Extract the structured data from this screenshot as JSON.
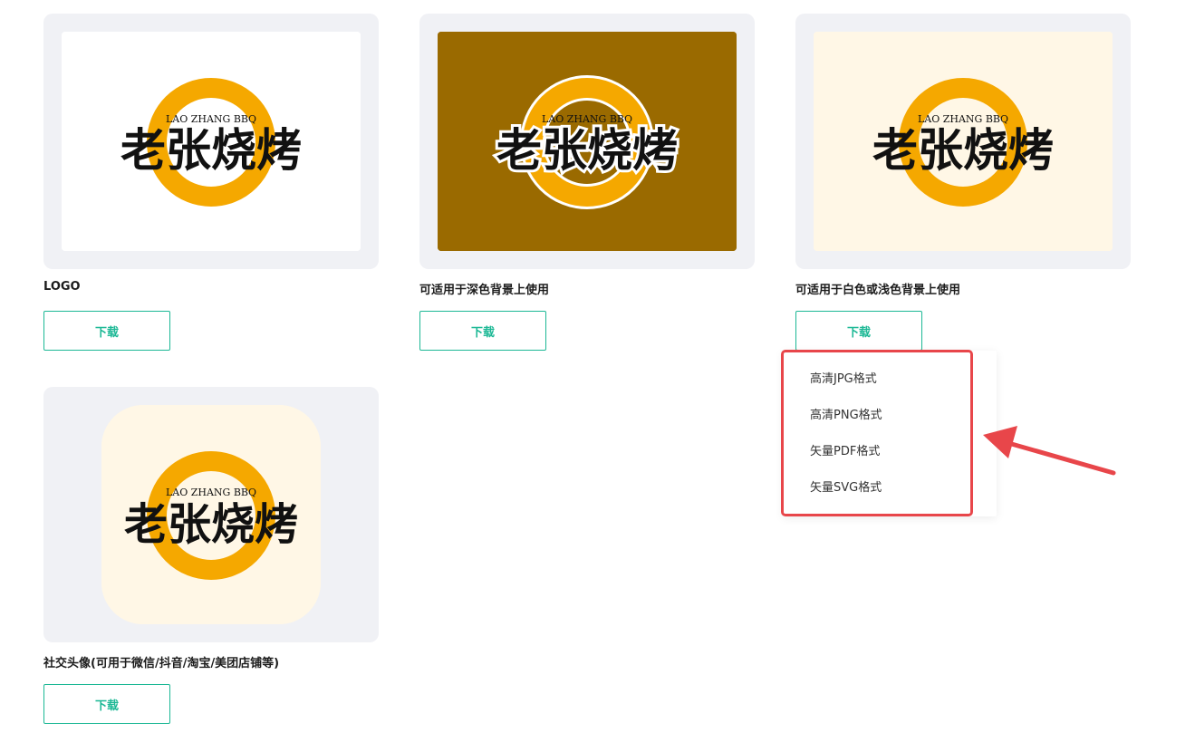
{
  "brand": {
    "chinese_name": "老张烧烤",
    "english_name": "LAO ZHANG BBQ"
  },
  "cards": [
    {
      "caption": "LOGO",
      "background": "#ffffff",
      "download_label": "下载"
    },
    {
      "caption": "可适用于深色背景上使用",
      "background": "#9a6a00",
      "download_label": "下载"
    },
    {
      "caption": "可适用于白色或浅色背景上使用",
      "background": "#fff7e6",
      "download_label": "下载"
    },
    {
      "caption": "社交头像(可用于微信/抖音/淘宝/美团店铺等)",
      "background": "#fff7e6",
      "download_label": "下载"
    }
  ],
  "dropdown": {
    "items": [
      "高清JPG格式",
      "高清PNG格式",
      "矢量PDF格式",
      "矢量SVG格式"
    ]
  },
  "colors": {
    "accent": "#1cb895",
    "ring": "#f5a800",
    "highlight": "#e8464a",
    "card_bg": "#f0f1f5"
  }
}
